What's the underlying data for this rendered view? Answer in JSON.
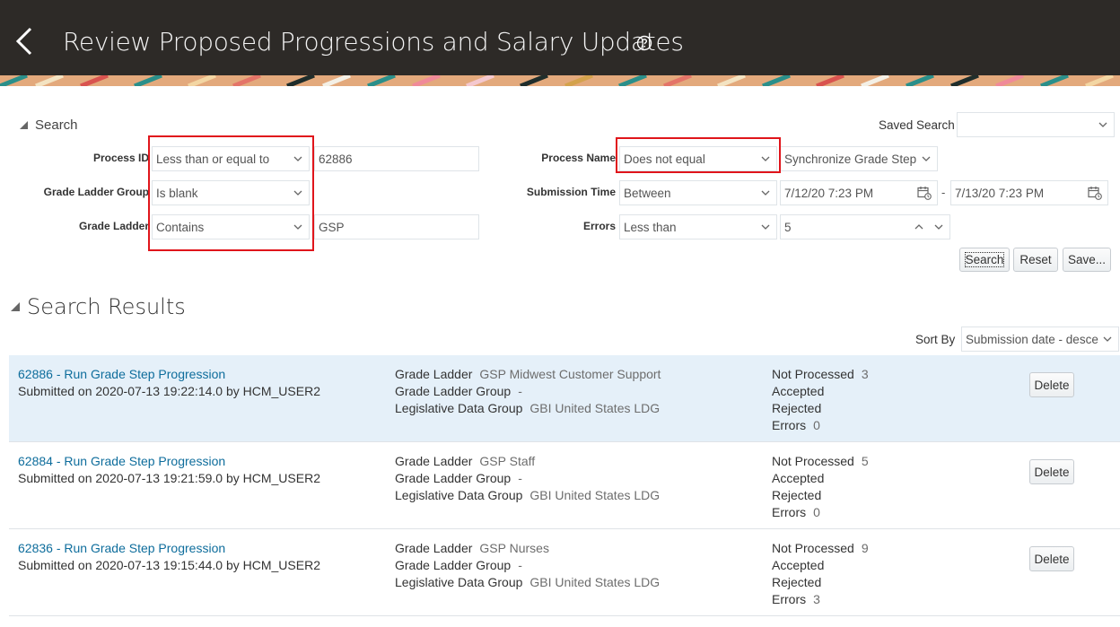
{
  "header": {
    "title": "Review Proposed Progressions and Salary Updates",
    "back_icon": "chevron-left-icon",
    "help_icon": "question-circle-icon",
    "bg_color": "#2d2a27"
  },
  "search": {
    "toggle_label": "Search",
    "saved_search_label": "Saved Search",
    "saved_search_value": "",
    "fields": {
      "process_id": {
        "label": "Process ID",
        "operator": "Less than or equal to",
        "value": "62886"
      },
      "grade_ladder_group": {
        "label": "Grade Ladder Group",
        "operator": "Is blank"
      },
      "grade_ladder": {
        "label": "Grade Ladder",
        "operator": "Contains",
        "value": "GSP"
      },
      "process_name": {
        "label": "Process Name",
        "operator": "Does not equal",
        "value": "Synchronize Grade Step"
      },
      "submission_time": {
        "label": "Submission Time",
        "operator": "Between",
        "from": "7/12/20 7:23 PM",
        "separator": "-",
        "to": "7/13/20 7:23 PM"
      },
      "errors": {
        "label": "Errors",
        "operator": "Less than",
        "value": "5"
      }
    },
    "buttons": {
      "search": "Search",
      "reset": "Reset",
      "save": "Save..."
    },
    "highlight_color": "#e0151b"
  },
  "results": {
    "title": "Search Results",
    "sort_by_label": "Sort By",
    "sort_by_value": "Submission date - desce",
    "delete_label": "Delete",
    "field_labels": {
      "grade_ladder": "Grade Ladder",
      "grade_ladder_group": "Grade Ladder Group",
      "legislative_data_group": "Legislative Data Group",
      "not_processed": "Not Processed",
      "accepted": "Accepted",
      "rejected": "Rejected",
      "errors": "Errors"
    },
    "items": [
      {
        "link": "62886 - Run Grade Step Progression",
        "submitted": "Submitted on 2020-07-13 19:22:14.0 by HCM_USER2",
        "grade_ladder": "GSP Midwest Customer Support",
        "grade_ladder_group": "-",
        "legislative_data_group": "GBI United States LDG",
        "not_processed": "3",
        "accepted": "",
        "rejected": "",
        "errors": "0"
      },
      {
        "link": "62884 - Run Grade Step Progression",
        "submitted": "Submitted on 2020-07-13 19:21:59.0 by HCM_USER2",
        "grade_ladder": "GSP Staff",
        "grade_ladder_group": "-",
        "legislative_data_group": "GBI United States LDG",
        "not_processed": "5",
        "accepted": "",
        "rejected": "",
        "errors": "0"
      },
      {
        "link": "62836 - Run Grade Step Progression",
        "submitted": "Submitted on 2020-07-13 19:15:44.0 by HCM_USER2",
        "grade_ladder": "GSP Nurses",
        "grade_ladder_group": "-",
        "legislative_data_group": "GBI United States LDG",
        "not_processed": "9",
        "accepted": "",
        "rejected": "",
        "errors": "3"
      }
    ]
  }
}
